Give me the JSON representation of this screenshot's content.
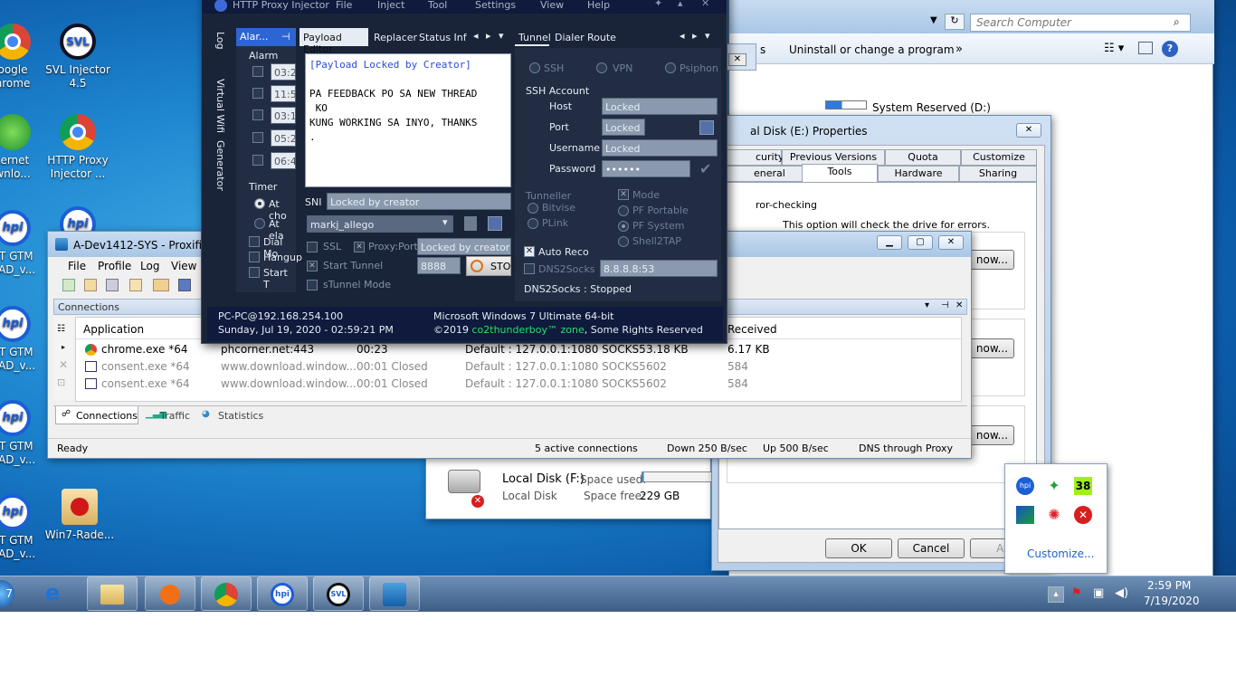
{
  "desktop": {
    "icons": [
      {
        "label": "oogle\nhrome"
      },
      {
        "label": "SVL Injector\n4.5"
      },
      {
        "label": "ternet\nwnlo..."
      },
      {
        "label": "HTTP Proxy\nInjector ..."
      },
      {
        "label": "ST GTM\nOAD_v..."
      },
      {
        "label": "ST GTM\nOAD_v..."
      },
      {
        "label": "ST GTM\nOAD_v..."
      },
      {
        "label": "ST GTM\nOAD_v..."
      },
      {
        "label": "Win7-Rade..."
      }
    ]
  },
  "explorer": {
    "search_placeholder": "Search Computer",
    "uninstall": "Uninstall or change a program",
    "more": "»",
    "drive_label": "System Reserved (D:)"
  },
  "props": {
    "title": "al Disk (E:) Properties",
    "tabs_row1": [
      "curity",
      "Previous Versions",
      "Quota",
      "Customize"
    ],
    "tabs_row2": [
      "eneral",
      "Tools",
      "Hardware",
      "Sharing"
    ],
    "group_label": "ror-checking",
    "desc": "This option will check the drive for errors.",
    "now1": "now...",
    "now2": "now...",
    "now3": "now...",
    "ok": "OK",
    "cancel": "Cancel",
    "apply": "Ap"
  },
  "drive_f": {
    "name": "Local Disk (F:)",
    "type": "Local Disk",
    "space_used_label": "Space used:",
    "space_free_label": "Space free:",
    "space_free": "229 GB"
  },
  "proxifier": {
    "title": "A-Dev1412-SYS - Proxifier",
    "menu": [
      "File",
      "Profile",
      "Log",
      "View"
    ],
    "panel": "Connections",
    "columns": [
      "Application",
      "Received"
    ],
    "rows": [
      {
        "app": "chrome.exe *64",
        "target": "phcorner.net:443",
        "time": "00:23",
        "rule": "Default : 127.0.0.1:1080 SOCKS5",
        "sent": "3.18 KB",
        "recv": "6.17 KB"
      },
      {
        "app": "consent.exe *64",
        "target": "www.download.window...",
        "time": "00:01 Closed",
        "rule": "Default : 127.0.0.1:1080 SOCKS5",
        "sent": "602",
        "recv": "584"
      },
      {
        "app": "consent.exe *64",
        "target": "www.download.window...",
        "time": "00:01 Closed",
        "rule": "Default : 127.0.0.1:1080 SOCKS5",
        "sent": "602",
        "recv": "584"
      }
    ],
    "tabs": [
      "Connections",
      "Traffic",
      "Statistics"
    ],
    "status": {
      "ready": "Ready",
      "active": "5 active connections",
      "down": "Down 250 B/sec",
      "up": "Up 500 B/sec",
      "dns": "DNS through Proxy"
    }
  },
  "injector": {
    "title": "HTTP Proxy Injector",
    "menu": [
      "File",
      "Inject",
      "Tool",
      "Settings",
      "View",
      "Help"
    ],
    "side_tabs": [
      "Log",
      "Virtual Wifi",
      "Generator"
    ],
    "alarm_tab": "Alar...",
    "alarm_label": "Alarm",
    "alarm_times": [
      "03:2",
      "11:5",
      "03:1",
      "05:2",
      "06:4"
    ],
    "timer_label": "Timer",
    "timer_opts": [
      "At cho",
      "At ela"
    ],
    "checks": [
      "Dial Mo",
      "Hangup",
      "Start T"
    ],
    "mid_tabs": [
      "Payload Editor",
      "Replacer",
      "Status Inf"
    ],
    "payload_lines": [
      "[Payload Locked by Creator]",
      "",
      "PA FEEDBACK PO SA NEW THREAD",
      "KO",
      "KUNG WORKING SA INYO, THANKS",
      ""
    ],
    "sni_label": "SNI",
    "sni_value": "Locked by creator",
    "profile": "markj_allego",
    "ssl": "SSL",
    "proxy_port_label": "Proxy:Port",
    "proxy_port_value": "Locked by creator",
    "start_tunnel": "Start Tunnel",
    "port": "8888",
    "stop": "STO",
    "stunnel": "sTunnel Mode",
    "right_tabs": [
      "Tunnel",
      "Dialer",
      "Route"
    ],
    "tunnel_types": [
      "SSH",
      "VPN",
      "Psiphon"
    ],
    "ssh_account": "SSH Account",
    "ssh_fields": [
      {
        "label": "Host",
        "value": "Locked"
      },
      {
        "label": "Port",
        "value": "Locked"
      },
      {
        "label": "Username",
        "value": "Locked"
      },
      {
        "label": "Password",
        "value": "••••••"
      }
    ],
    "tunneller": "Tunneller",
    "tun_opts": [
      "Bitvise",
      "PLink"
    ],
    "mode": "Mode",
    "mode_opts": [
      "PF Portable",
      "PF System",
      "Shell2TAP"
    ],
    "auto_reco": "Auto Reco",
    "dns2socks": "DNS2Socks",
    "dns_value": "8.8.8.8:53",
    "dns_status": "DNS2Socks : Stopped",
    "footer": {
      "host": "PC-PC@192.168.254.100",
      "date": "Sunday, Jul 19, 2020 - 02:59:21 PM",
      "os": "Microsoft Windows 7 Ultimate  64-bit",
      "copy_prefix": "©2019",
      "copy_brand": "co2thunderboy™ zone",
      "copy_suffix": ", Some Rights Reserved"
    }
  },
  "tray": {
    "badge": "38",
    "customize": "Customize..."
  },
  "clock": {
    "time": "2:59 PM",
    "date": "7/19/2020"
  }
}
